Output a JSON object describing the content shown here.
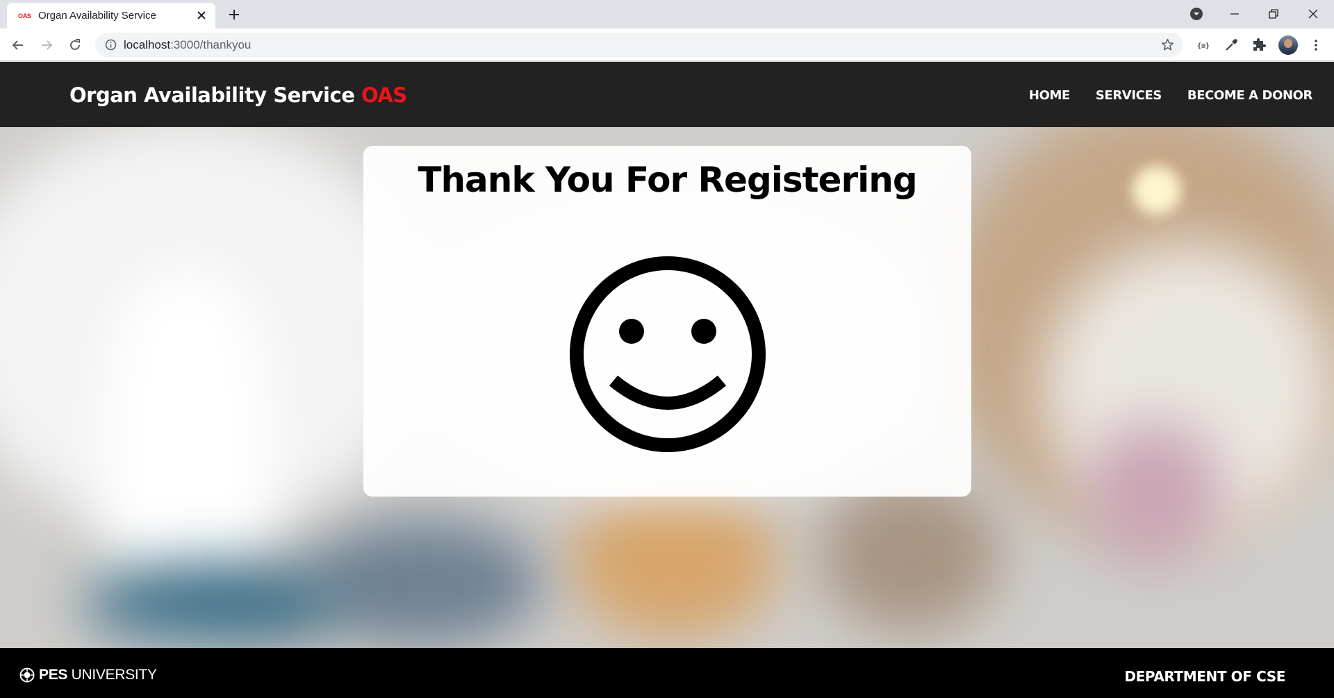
{
  "browser": {
    "tab_favicon_text": "OAS",
    "tab_title": "Organ Availability Service",
    "url_host": "localhost",
    "url_path": ":3000/thankyou"
  },
  "site": {
    "brand_name": "Organ Availability Service",
    "brand_accent": "OAS",
    "accent_color": "#e8161b",
    "nav": [
      {
        "label": "HOME"
      },
      {
        "label": "SERVICES"
      },
      {
        "label": "BECOME A DONOR"
      }
    ]
  },
  "main": {
    "heading": "Thank You For Registering",
    "icon": "smiley-face-icon"
  },
  "footer": {
    "logo_bold": "PES",
    "logo_text": "UNIVERSITY",
    "department": "DEPARTMENT OF CSE"
  }
}
